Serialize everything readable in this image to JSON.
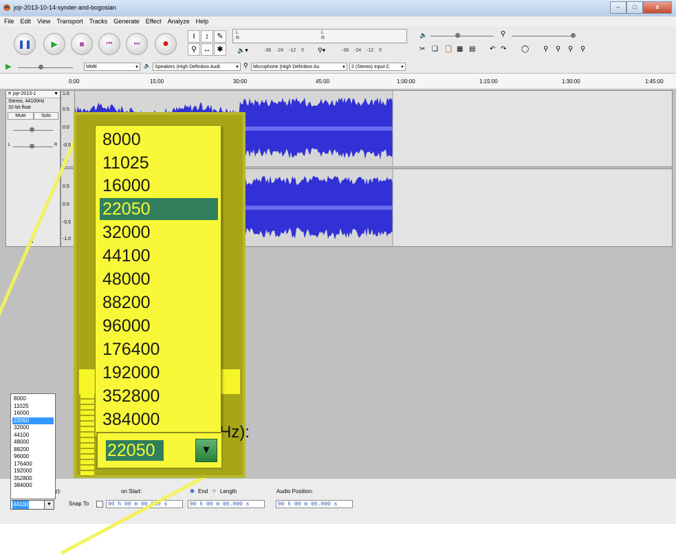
{
  "window": {
    "title": "jojr-2013-10-14-synder-and-bogosian",
    "minimize": "–",
    "maximize": "□",
    "close": "x"
  },
  "menu": {
    "items": [
      "File",
      "Edit",
      "View",
      "Transport",
      "Tracks",
      "Generate",
      "Effect",
      "Analyze",
      "Help"
    ]
  },
  "meters": {
    "play_lr": "L\nR",
    "db_labels": [
      "-36",
      "-24",
      "-12",
      "0"
    ]
  },
  "device_toolbar": {
    "host": "MME",
    "output": "Speakers (High Definition Audi",
    "input": "Microphone (High Definition Au",
    "channels": "2 (Stereo) Input C"
  },
  "ruler": {
    "ticks": [
      "0:00",
      "15:00",
      "30:00",
      "45:00",
      "1:00:00",
      "1:15:00",
      "1:30:00",
      "1:45:00"
    ]
  },
  "track": {
    "name": "jojr-2013-1",
    "rate": "Stereo, 44100Hz",
    "format": "32-bit float",
    "mute": "Mute",
    "solo": "Solo",
    "scale_top": [
      "1.0",
      "0.5",
      "0.0",
      "-0.5",
      "-1."
    ],
    "scale_bottom": [
      "0.5",
      "0.0",
      "-0.5",
      "-1.0"
    ]
  },
  "sample_rates": [
    "8000",
    "11025",
    "16000",
    "22050",
    "32000",
    "44100",
    "48000",
    "88200",
    "96000",
    "176400",
    "192000",
    "352800",
    "384000"
  ],
  "zoom": {
    "selected": "22050",
    "label_fragment": "Hz):"
  },
  "selection_bar": {
    "project_rate_fragment": "z):",
    "project_rate_value": "44100",
    "snap_to": "Snap To",
    "selection_start": "on Start:",
    "end_label": "End",
    "length_label": "Length",
    "audio_position": "Audio Position:",
    "time_value": "00 h 00 m 00.000 s"
  }
}
